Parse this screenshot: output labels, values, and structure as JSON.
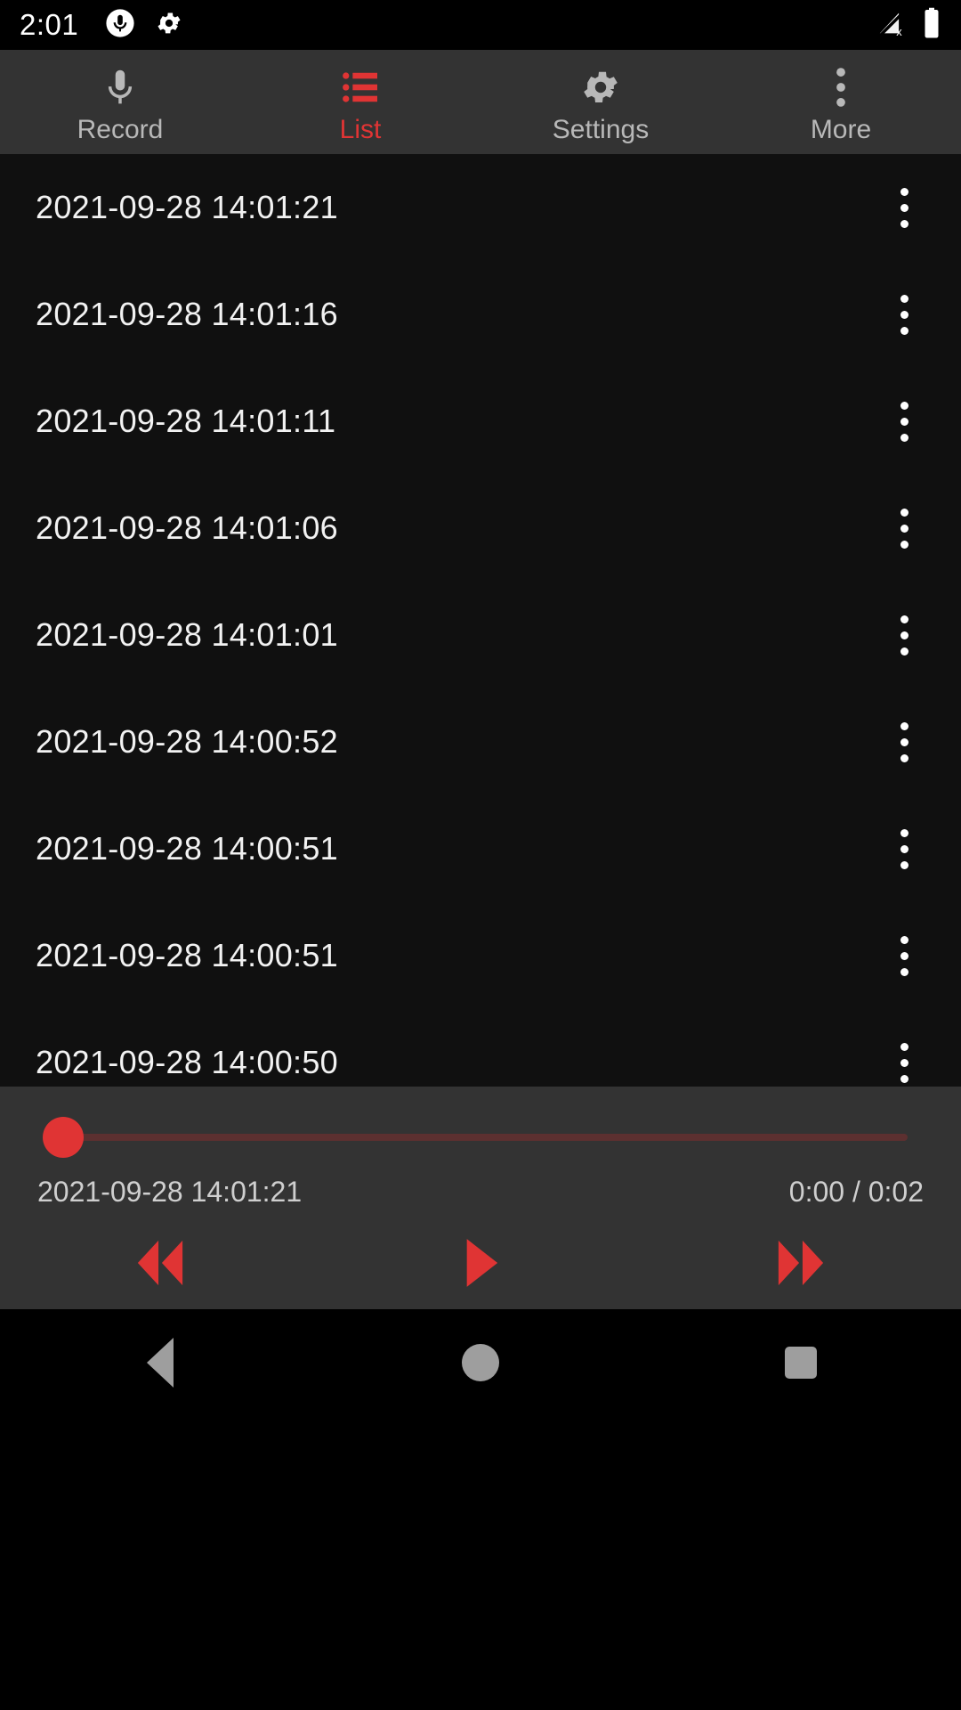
{
  "status_bar": {
    "time": "2:01",
    "left_icons": [
      "microphone-recording-icon",
      "gear-icon"
    ],
    "right_icons": [
      "signal-off-icon",
      "battery-full-icon"
    ]
  },
  "tabs": [
    {
      "label": "Record",
      "icon": "microphone-icon",
      "active": false
    },
    {
      "label": "List",
      "icon": "list-icon",
      "active": true
    },
    {
      "label": "Settings",
      "icon": "gear-icon",
      "active": false
    },
    {
      "label": "More",
      "icon": "more-vert-icon",
      "active": false
    }
  ],
  "recordings": [
    {
      "name": "2021-09-28 14:01:21"
    },
    {
      "name": "2021-09-28 14:01:16"
    },
    {
      "name": "2021-09-28 14:01:11"
    },
    {
      "name": "2021-09-28 14:01:06"
    },
    {
      "name": "2021-09-28 14:01:01"
    },
    {
      "name": "2021-09-28 14:00:52"
    },
    {
      "name": "2021-09-28 14:00:51"
    },
    {
      "name": "2021-09-28 14:00:51"
    },
    {
      "name": "2021-09-28 14:00:50"
    }
  ],
  "player": {
    "now_playing": "2021-09-28 14:01:21",
    "time_display": "0:00 / 0:02",
    "elapsed": "0:00",
    "duration": "0:02",
    "progress_percent": 0,
    "controls": [
      "rewind-icon",
      "play-icon",
      "fast-forward-icon"
    ]
  },
  "nav_bar": {
    "items": [
      "back-icon",
      "home-icon",
      "recents-icon"
    ]
  },
  "colors": {
    "accent_red": "#E03434",
    "seek_track": "#5C3030",
    "panel_gray": "#333333",
    "list_bg": "#101010",
    "tab_inactive": "#B8B8B8",
    "nav_icon": "#9E9E9E"
  }
}
